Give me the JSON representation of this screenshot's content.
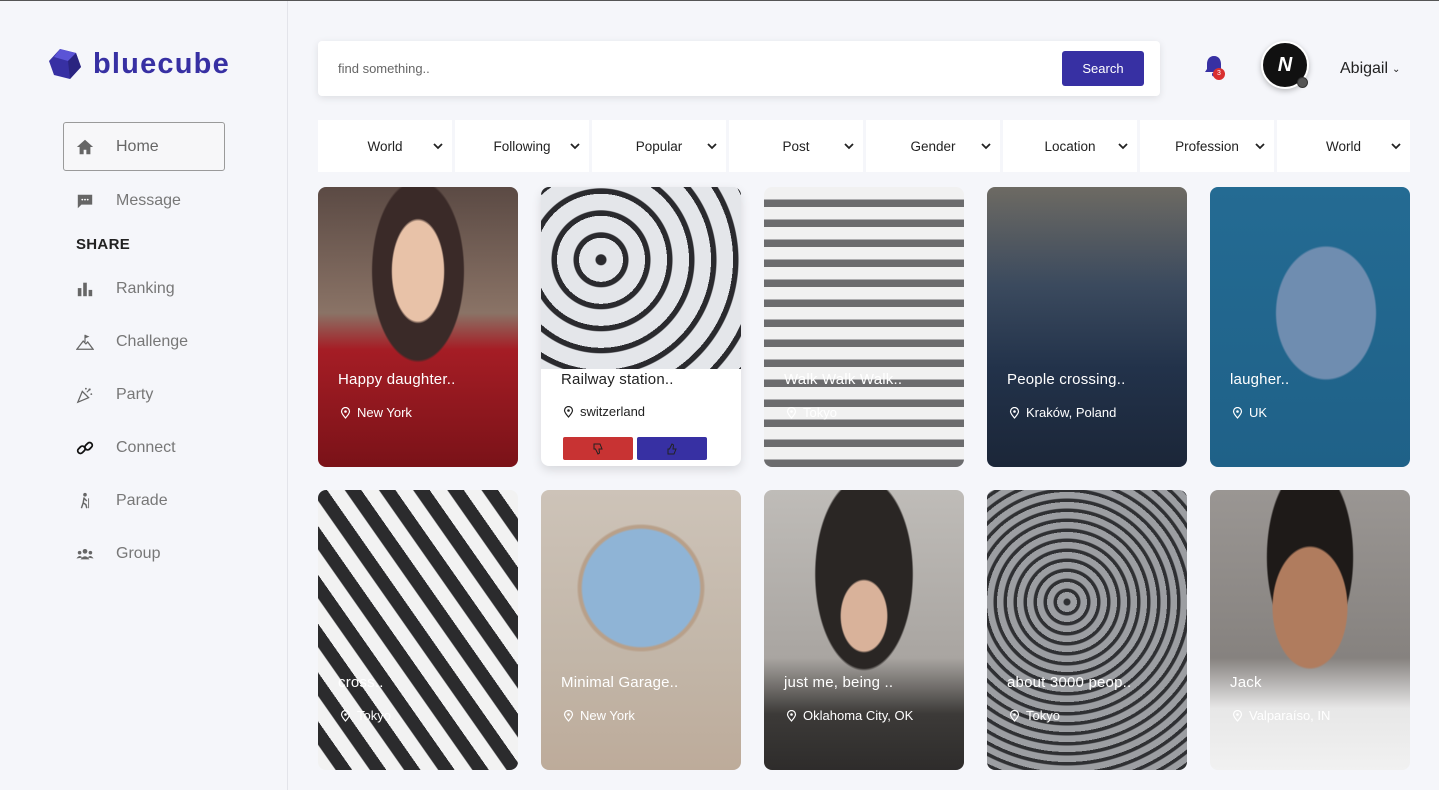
{
  "brand": {
    "name": "bluecube",
    "color": "#3730a3"
  },
  "sidebar": {
    "items": [
      {
        "label": "Home",
        "icon": "home-icon",
        "active": true
      },
      {
        "label": "Message",
        "icon": "message-icon"
      }
    ],
    "share_heading": "SHARE",
    "share_items": [
      {
        "label": "Ranking",
        "icon": "bar-chart-icon"
      },
      {
        "label": "Challenge",
        "icon": "mountain-flag-icon"
      },
      {
        "label": "Party",
        "icon": "party-popper-icon"
      },
      {
        "label": "Connect",
        "icon": "link-icon"
      },
      {
        "label": "Parade",
        "icon": "hiker-icon"
      },
      {
        "label": "Group",
        "icon": "group-icon"
      }
    ]
  },
  "search": {
    "placeholder": "find something..",
    "button_label": "Search"
  },
  "notifications": {
    "count": "3",
    "badge_color": "#d93030",
    "bell_color": "#3730a3"
  },
  "user": {
    "name": "Abigail",
    "avatar_icon": "avatar-icon"
  },
  "filters": [
    "World",
    "Following",
    "Popular",
    "Post",
    "Gender",
    "Location",
    "Profession",
    "World"
  ],
  "cards": [
    {
      "title": "Happy daughter..",
      "location": "New York"
    },
    {
      "title": "Railway station..",
      "location": "switzerland",
      "dislike_color": "#c83333",
      "like_color": "#3730a3"
    },
    {
      "title": "Walk Walk Walk..",
      "location": "Tokyo"
    },
    {
      "title": "People crossing..",
      "location": "Kraków, Poland"
    },
    {
      "title": "laugher..",
      "location": "UK"
    },
    {
      "title": "cross..",
      "location": "Tokyo"
    },
    {
      "title": "Minimal Garage..",
      "location": "New York"
    },
    {
      "title": "just me, being ..",
      "location": "Oklahoma City, OK"
    },
    {
      "title": "about 3000 peop..",
      "location": "Tokyo"
    },
    {
      "title": "Jack",
      "location": "Valparaíso, IN"
    }
  ]
}
